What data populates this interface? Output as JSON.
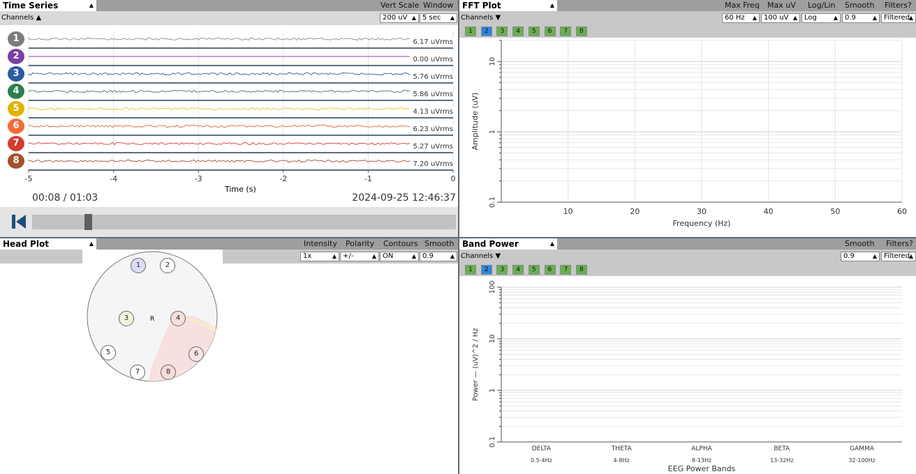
{
  "time_series": {
    "title": "Time Series",
    "vert_scale_label": "Vert Scale",
    "window_label": "Window",
    "vert_scale_value": "200 uV",
    "window_value": "5 sec",
    "channels_label": "Channels ▲",
    "channels": [
      {
        "num": "1",
        "rms": "6.17 uVrms",
        "color": "#7d7d7d",
        "trace": "#8a8a8a"
      },
      {
        "num": "2",
        "rms": "0.00 uVrms",
        "color": "#7b3f9e",
        "trace": "#8e44ad"
      },
      {
        "num": "3",
        "rms": "5.76 uVrms",
        "color": "#2c5aa0",
        "trace": "#2c5aa0"
      },
      {
        "num": "4",
        "rms": "5.86 uVrms",
        "color": "#2e7d4f",
        "trace": "#3d7a5a"
      },
      {
        "num": "5",
        "rms": "4.13 uVrms",
        "color": "#e0b400",
        "trace": "#e6c229"
      },
      {
        "num": "6",
        "rms": "6.23 uVrms",
        "color": "#f26b3a",
        "trace": "#e8613a"
      },
      {
        "num": "7",
        "rms": "5.27 uVrms",
        "color": "#d63b2f",
        "trace": "#d63b2f"
      },
      {
        "num": "8",
        "rms": "7.20 uVrms",
        "color": "#a0522d",
        "trace": "#a0522d"
      }
    ],
    "x_ticks": [
      "-5",
      "-4",
      "-3",
      "-2",
      "-1",
      "0"
    ],
    "x_axis_label": "Time (s)",
    "playback_time": "00:08 / 01:03",
    "timestamp": "2024-09-25 12:46:37"
  },
  "fft_plot": {
    "title": "FFT Plot",
    "max_freq_label": "Max Freq",
    "max_uv_label": "Max uV",
    "log_lin_label": "Log/Lin",
    "smooth_label": "Smooth",
    "filters_label": "Filters?",
    "max_freq_value": "60 Hz",
    "max_uv_value": "100 uV",
    "log_lin_value": "Log",
    "smooth_value": "0.9",
    "filters_value": "Filtered",
    "channels_label": "Channels ▼",
    "chips": [
      "1",
      "2",
      "3",
      "4",
      "5",
      "6",
      "7",
      "8"
    ],
    "y_axis_label": "Amplitude (uV)",
    "x_axis_label": "Frequency (Hz)",
    "y_ticks": [
      "10",
      "1",
      "0.1"
    ],
    "x_ticks": [
      "10",
      "20",
      "30",
      "40",
      "50",
      "60"
    ]
  },
  "head_plot": {
    "title": "Head Plot",
    "intensity_label": "Intensity",
    "polarity_label": "Polarity",
    "contours_label": "Contours",
    "smooth_label": "Smooth",
    "intensity_value": "1x",
    "polarity_value": "+/-",
    "contours_value": "ON",
    "smooth_value": "0.9",
    "reference_label": "R",
    "electrodes": [
      "1",
      "2",
      "3",
      "4",
      "5",
      "6",
      "7",
      "8"
    ]
  },
  "band_power": {
    "title": "Band Power",
    "smooth_label": "Smooth",
    "filters_label": "Filters?",
    "smooth_value": "0.9",
    "filters_value": "Filtered",
    "channels_label": "Channels ▼",
    "chips": [
      "1",
      "2",
      "3",
      "4",
      "5",
      "6",
      "7",
      "8"
    ],
    "y_axis_label": "Power — (uV)^2 / Hz",
    "y_ticks": [
      "100",
      "10",
      "1",
      "0.1"
    ],
    "bands": [
      {
        "name": "DELTA",
        "range": "0.5-4Hz"
      },
      {
        "name": "THETA",
        "range": "4-8Hz"
      },
      {
        "name": "ALPHA",
        "range": "8-13Hz"
      },
      {
        "name": "BETA",
        "range": "13-32Hz"
      },
      {
        "name": "GAMMA",
        "range": "32-100Hz"
      }
    ],
    "x_axis_label": "EEG Power Bands"
  }
}
